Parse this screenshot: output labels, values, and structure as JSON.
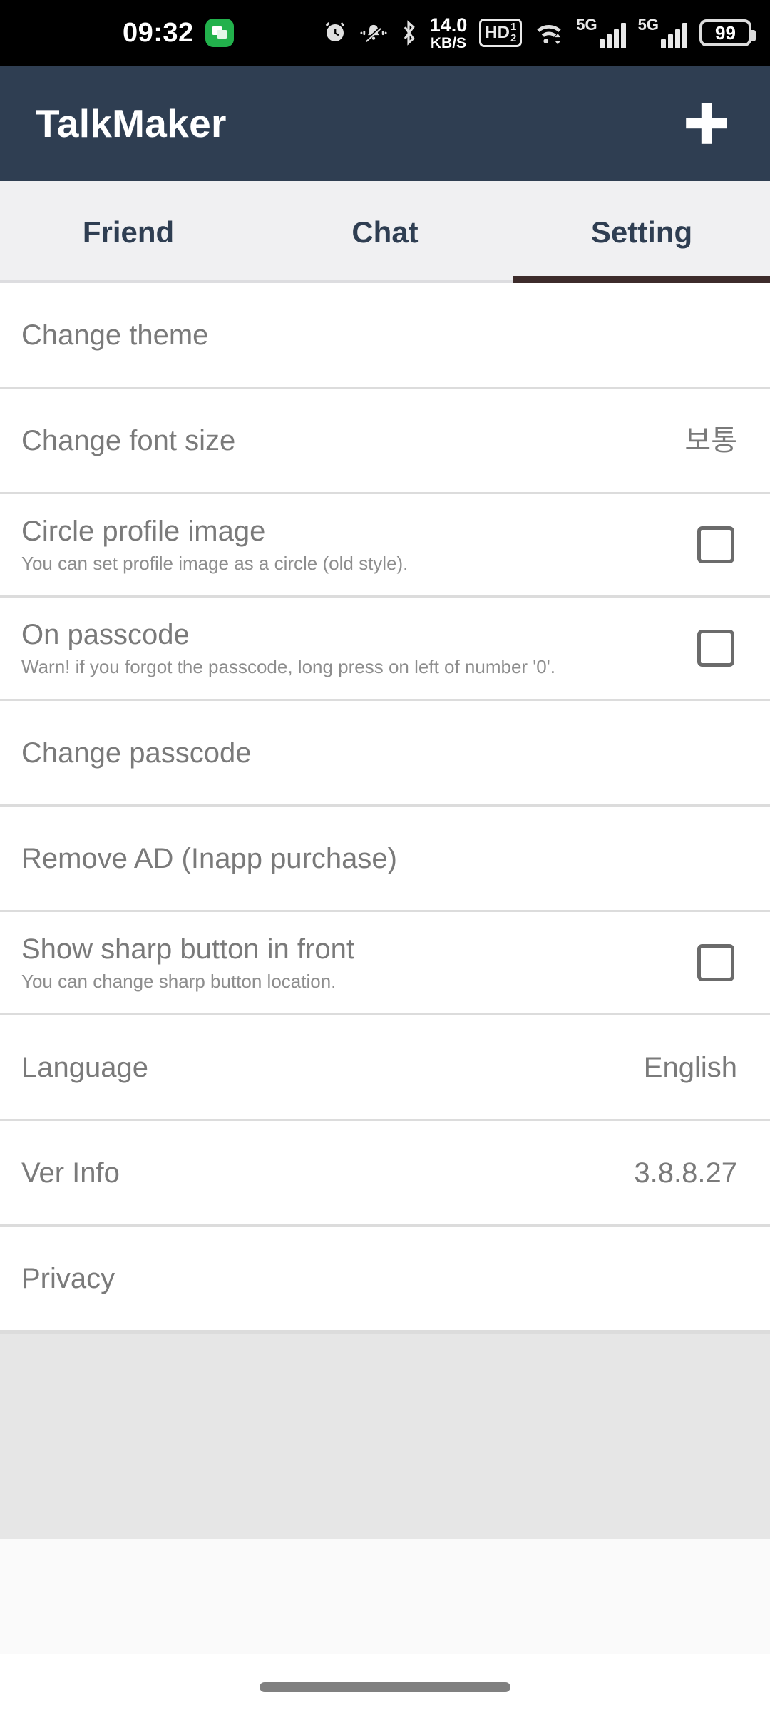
{
  "status_bar": {
    "time": "09:32",
    "notification_icon": "chat-bubble-icon",
    "network_speed_value": "14.0",
    "network_speed_unit": "KB/S",
    "hd_label": "HD",
    "hd_fraction_top": "1",
    "hd_fraction_bottom": "2",
    "cellular_1_label": "5G",
    "cellular_2_label": "5G",
    "battery_level": "99",
    "icons": [
      "alarm-clock-icon",
      "bell-muted-icon",
      "bluetooth-icon",
      "wifi-icon",
      "signal-bars-icon",
      "battery-icon"
    ]
  },
  "app_bar": {
    "title": "TalkMaker",
    "add_button_label": "+",
    "background_color": "#2f3e52"
  },
  "tabs": {
    "items": [
      {
        "label": "Friend",
        "active": false
      },
      {
        "label": "Chat",
        "active": false
      },
      {
        "label": "Setting",
        "active": true
      }
    ],
    "active_indicator_color": "#3d2b2b",
    "background_color": "#f0f0f2"
  },
  "settings": {
    "rows": [
      {
        "title": "Change theme",
        "subtitle": "",
        "value": "",
        "control": "none"
      },
      {
        "title": "Change font size",
        "subtitle": "",
        "value": "보통",
        "control": "none"
      },
      {
        "title": "Circle profile image",
        "subtitle": "You can set profile image as a circle (old style).",
        "value": "",
        "control": "checkbox",
        "checked": false
      },
      {
        "title": "On passcode",
        "subtitle": "Warn! if you forgot the passcode, long press on left of number '0'.",
        "value": "",
        "control": "checkbox",
        "checked": false
      },
      {
        "title": "Change passcode",
        "subtitle": "",
        "value": "",
        "control": "none"
      },
      {
        "title": "Remove AD (Inapp purchase)",
        "subtitle": "",
        "value": "",
        "control": "none"
      },
      {
        "title": "Show sharp button in front",
        "subtitle": "You can change sharp button location.",
        "value": "",
        "control": "checkbox",
        "checked": false
      },
      {
        "title": "Language",
        "subtitle": "",
        "value": "English",
        "control": "none"
      },
      {
        "title": "Ver Info",
        "subtitle": "",
        "value": "3.8.8.27",
        "control": "none"
      },
      {
        "title": "Privacy",
        "subtitle": "",
        "value": "",
        "control": "none"
      }
    ]
  },
  "ad_slot": {
    "label": "",
    "background_color": "#e6e6e6"
  },
  "nav_bar": {
    "handle_label": "gesture-handle"
  }
}
